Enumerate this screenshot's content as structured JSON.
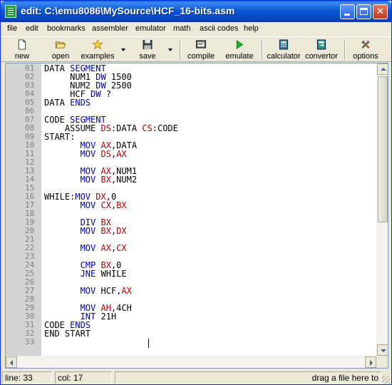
{
  "window": {
    "title": "edit: C:\\emu8086\\MySource\\HCF_16-bits.asm"
  },
  "menu": [
    "file",
    "edit",
    "bookmarks",
    "assembler",
    "emulator",
    "math",
    "ascii codes",
    "help"
  ],
  "toolbar": {
    "new": "new",
    "open": "open",
    "examples": "examples",
    "save": "save",
    "compile": "compile",
    "emulate": "emulate",
    "calculator": "calculator",
    "convertor": "convertor",
    "options": "options"
  },
  "editor": {
    "lines": [
      {
        "n": "01",
        "tokens": [
          [
            "t",
            "DATA "
          ],
          [
            "k",
            "SEGMENT"
          ]
        ]
      },
      {
        "n": "02",
        "tokens": [
          [
            "t",
            "     NUM1 "
          ],
          [
            "k",
            "DW"
          ],
          [
            "t",
            " 1500"
          ]
        ]
      },
      {
        "n": "03",
        "tokens": [
          [
            "t",
            "     NUM2 "
          ],
          [
            "k",
            "DW"
          ],
          [
            "t",
            " 2500"
          ]
        ]
      },
      {
        "n": "04",
        "tokens": [
          [
            "t",
            "     HCF "
          ],
          [
            "k",
            "DW"
          ],
          [
            "t",
            " ?"
          ]
        ]
      },
      {
        "n": "05",
        "tokens": [
          [
            "t",
            "DATA "
          ],
          [
            "k",
            "ENDS"
          ]
        ]
      },
      {
        "n": "06",
        "tokens": []
      },
      {
        "n": "07",
        "tokens": [
          [
            "t",
            "CODE "
          ],
          [
            "k",
            "SEGMENT"
          ]
        ]
      },
      {
        "n": "08",
        "tokens": [
          [
            "t",
            "    ASSUME "
          ],
          [
            "r",
            "DS"
          ],
          [
            "t",
            ":DATA "
          ],
          [
            "r",
            "CS"
          ],
          [
            "t",
            ":CODE"
          ]
        ]
      },
      {
        "n": "09",
        "tokens": [
          [
            "t",
            "START:"
          ]
        ]
      },
      {
        "n": "10",
        "tokens": [
          [
            "t",
            "       "
          ],
          [
            "k",
            "MOV"
          ],
          [
            "t",
            " "
          ],
          [
            "r",
            "AX"
          ],
          [
            "t",
            ",DATA"
          ]
        ]
      },
      {
        "n": "11",
        "tokens": [
          [
            "t",
            "       "
          ],
          [
            "k",
            "MOV"
          ],
          [
            "t",
            " "
          ],
          [
            "r",
            "DS"
          ],
          [
            "t",
            ","
          ],
          [
            "r",
            "AX"
          ]
        ]
      },
      {
        "n": "12",
        "tokens": []
      },
      {
        "n": "13",
        "tokens": [
          [
            "t",
            "       "
          ],
          [
            "k",
            "MOV"
          ],
          [
            "t",
            " "
          ],
          [
            "r",
            "AX"
          ],
          [
            "t",
            ",NUM1"
          ]
        ]
      },
      {
        "n": "14",
        "tokens": [
          [
            "t",
            "       "
          ],
          [
            "k",
            "MOV"
          ],
          [
            "t",
            " "
          ],
          [
            "r",
            "BX"
          ],
          [
            "t",
            ",NUM2"
          ]
        ]
      },
      {
        "n": "15",
        "tokens": []
      },
      {
        "n": "16",
        "tokens": [
          [
            "t",
            "WHILE:"
          ],
          [
            "k",
            "MOV"
          ],
          [
            "t",
            " "
          ],
          [
            "r",
            "DX"
          ],
          [
            "t",
            ",0"
          ]
        ]
      },
      {
        "n": "17",
        "tokens": [
          [
            "t",
            "       "
          ],
          [
            "k",
            "MOV"
          ],
          [
            "t",
            " "
          ],
          [
            "r",
            "CX"
          ],
          [
            "t",
            ","
          ],
          [
            "r",
            "BX"
          ]
        ]
      },
      {
        "n": "18",
        "tokens": []
      },
      {
        "n": "19",
        "tokens": [
          [
            "t",
            "       "
          ],
          [
            "k",
            "DIV"
          ],
          [
            "t",
            " "
          ],
          [
            "r",
            "BX"
          ]
        ]
      },
      {
        "n": "20",
        "tokens": [
          [
            "t",
            "       "
          ],
          [
            "k",
            "MOV"
          ],
          [
            "t",
            " "
          ],
          [
            "r",
            "BX"
          ],
          [
            "t",
            ","
          ],
          [
            "r",
            "DX"
          ]
        ]
      },
      {
        "n": "21",
        "tokens": []
      },
      {
        "n": "22",
        "tokens": [
          [
            "t",
            "       "
          ],
          [
            "k",
            "MOV"
          ],
          [
            "t",
            " "
          ],
          [
            "r",
            "AX"
          ],
          [
            "t",
            ","
          ],
          [
            "r",
            "CX"
          ]
        ]
      },
      {
        "n": "23",
        "tokens": []
      },
      {
        "n": "24",
        "tokens": [
          [
            "t",
            "       "
          ],
          [
            "k",
            "CMP"
          ],
          [
            "t",
            " "
          ],
          [
            "r",
            "BX"
          ],
          [
            "t",
            ",0"
          ]
        ]
      },
      {
        "n": "25",
        "tokens": [
          [
            "t",
            "       "
          ],
          [
            "k",
            "JNE"
          ],
          [
            "t",
            " WHILE"
          ]
        ]
      },
      {
        "n": "26",
        "tokens": []
      },
      {
        "n": "27",
        "tokens": [
          [
            "t",
            "       "
          ],
          [
            "k",
            "MOV"
          ],
          [
            "t",
            " HCF,"
          ],
          [
            "r",
            "AX"
          ]
        ]
      },
      {
        "n": "28",
        "tokens": []
      },
      {
        "n": "29",
        "tokens": [
          [
            "t",
            "       "
          ],
          [
            "k",
            "MOV"
          ],
          [
            "t",
            " "
          ],
          [
            "r",
            "AH"
          ],
          [
            "t",
            ",4CH"
          ]
        ]
      },
      {
        "n": "30",
        "tokens": [
          [
            "t",
            "       "
          ],
          [
            "k",
            "INT"
          ],
          [
            "t",
            " 21H"
          ]
        ]
      },
      {
        "n": "31",
        "tokens": [
          [
            "t",
            "CODE "
          ],
          [
            "k",
            "ENDS"
          ]
        ]
      },
      {
        "n": "32",
        "tokens": [
          [
            "t",
            "END START"
          ]
        ]
      },
      {
        "n": "33",
        "tokens": []
      }
    ]
  },
  "status": {
    "line": "line: 33",
    "col": "col: 17",
    "hint": "drag a file here to"
  },
  "colors": {
    "keyword": "#0000a0",
    "register": "#b00000",
    "text": "#000000",
    "gutter": "#d4d4d4",
    "title_bar": "#0a58d6"
  }
}
